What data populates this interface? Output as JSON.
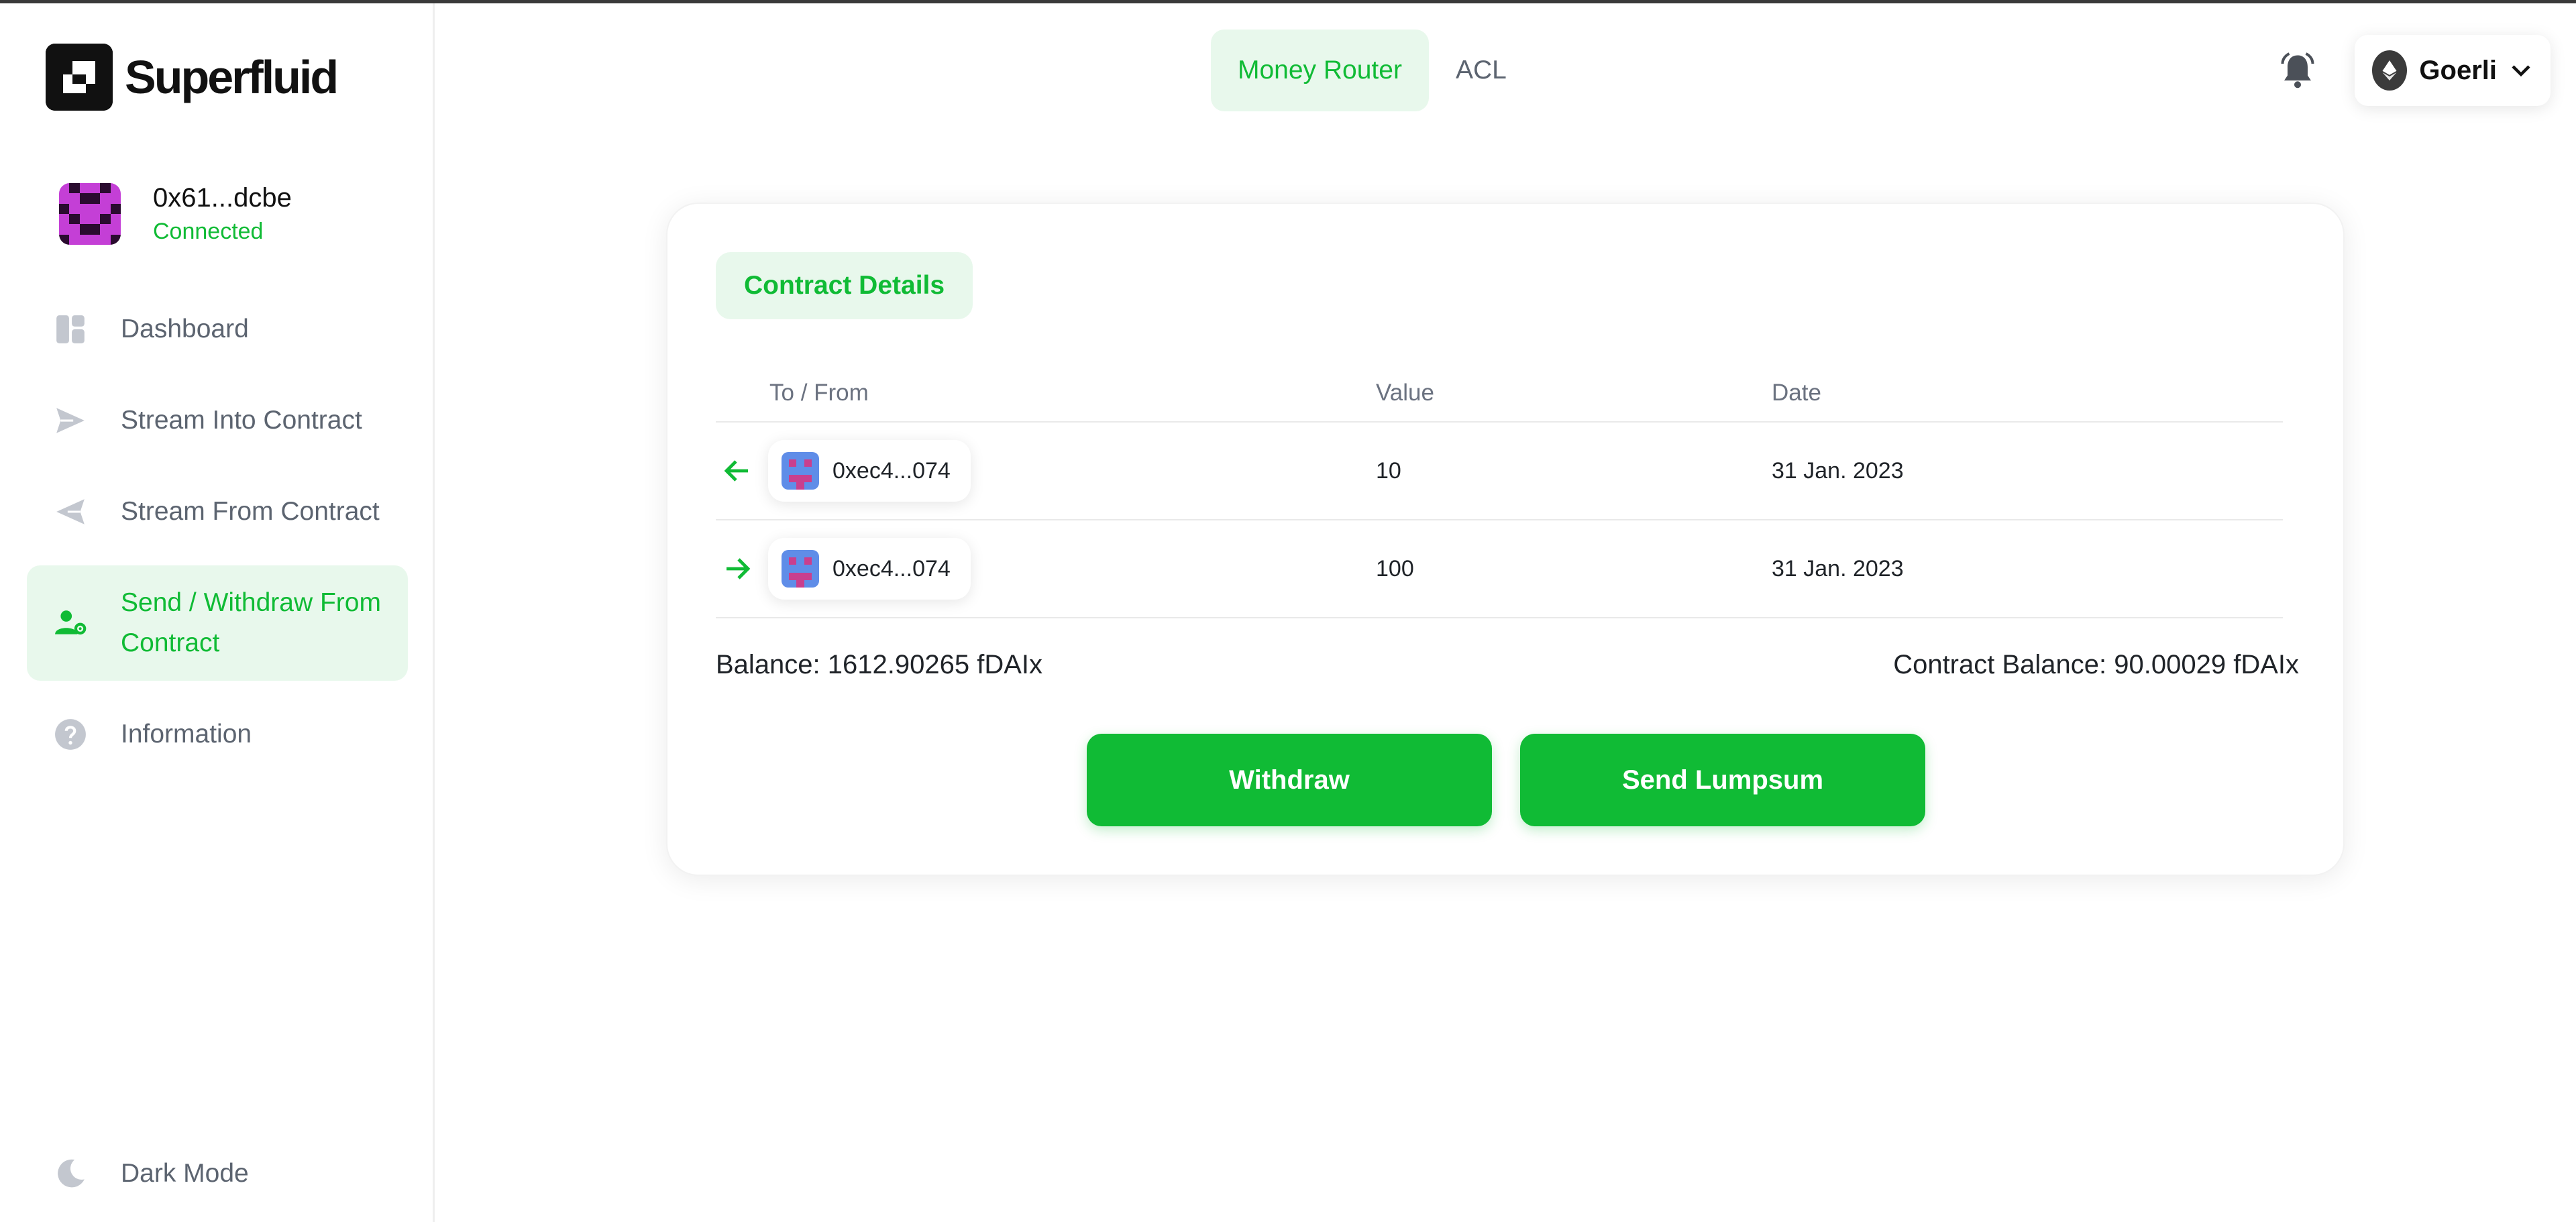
{
  "app": {
    "brand": "Superfluid"
  },
  "account": {
    "address": "0x61...dcbe",
    "status": "Connected"
  },
  "sidebar": {
    "items": [
      {
        "label": "Dashboard",
        "icon": "dashboard-icon"
      },
      {
        "label": "Stream Into Contract",
        "icon": "send-icon"
      },
      {
        "label": "Stream From Contract",
        "icon": "receive-icon"
      },
      {
        "label": "Send / Withdraw From Contract",
        "icon": "user-gear-icon"
      },
      {
        "label": "Information",
        "icon": "question-icon"
      }
    ],
    "active_index": 3,
    "dark_mode_label": "Dark Mode"
  },
  "header": {
    "tabs": [
      {
        "label": "Money Router",
        "active": true
      },
      {
        "label": "ACL",
        "active": false
      }
    ],
    "network": "Goerli"
  },
  "card": {
    "chip_label": "Contract Details",
    "columns": [
      "To / From",
      "Value",
      "Date"
    ],
    "rows": [
      {
        "direction": "in",
        "address": "0xec4...074",
        "value": "10",
        "date": "31 Jan. 2023"
      },
      {
        "direction": "out",
        "address": "0xec4...074",
        "value": "100",
        "date": "31 Jan. 2023"
      }
    ],
    "balance": "Balance: 1612.90265 fDAIx",
    "contract_balance": "Contract Balance: 90.00029 fDAIx",
    "withdraw_label": "Withdraw",
    "send_label": "Send Lumpsum"
  },
  "colors": {
    "accent": "#10bb35",
    "accent_soft": "#e8f8ec",
    "text_muted": "#5c6470"
  }
}
